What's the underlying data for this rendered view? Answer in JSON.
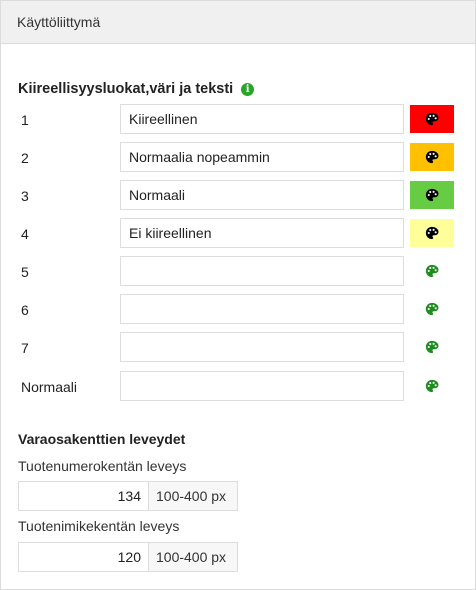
{
  "panel": {
    "title": "Käyttöliittymä"
  },
  "urgency": {
    "title": "Kiireellisyysluokat,väri ja teksti",
    "rows": [
      {
        "label": "1",
        "value": "Kiireellinen",
        "color": "#ff0000",
        "icon_color": "#000000"
      },
      {
        "label": "2",
        "value": "Normaalia nopeammin",
        "color": "#ffc000",
        "icon_color": "#000000"
      },
      {
        "label": "3",
        "value": "Normaali",
        "color": "#66cc44",
        "icon_color": "#000000"
      },
      {
        "label": "4",
        "value": "Ei kiireellinen",
        "color": "#ffff99",
        "icon_color": "#000000"
      },
      {
        "label": "5",
        "value": "",
        "color": "",
        "icon_color": "#1e8c1e"
      },
      {
        "label": "6",
        "value": "",
        "color": "",
        "icon_color": "#1e8c1e"
      },
      {
        "label": "7",
        "value": "",
        "color": "",
        "icon_color": "#1e8c1e"
      },
      {
        "label": "Normaali",
        "value": "",
        "color": "",
        "icon_color": "#1e8c1e"
      }
    ]
  },
  "spare_fields": {
    "title": "Varaosakenttien leveydet",
    "product_number": {
      "label": "Tuotenumerokentän leveys",
      "value": "134",
      "range": "100-400 px"
    },
    "product_name": {
      "label": "Tuotenimikekentän leveys",
      "value": "120",
      "range": "100-400 px"
    }
  }
}
